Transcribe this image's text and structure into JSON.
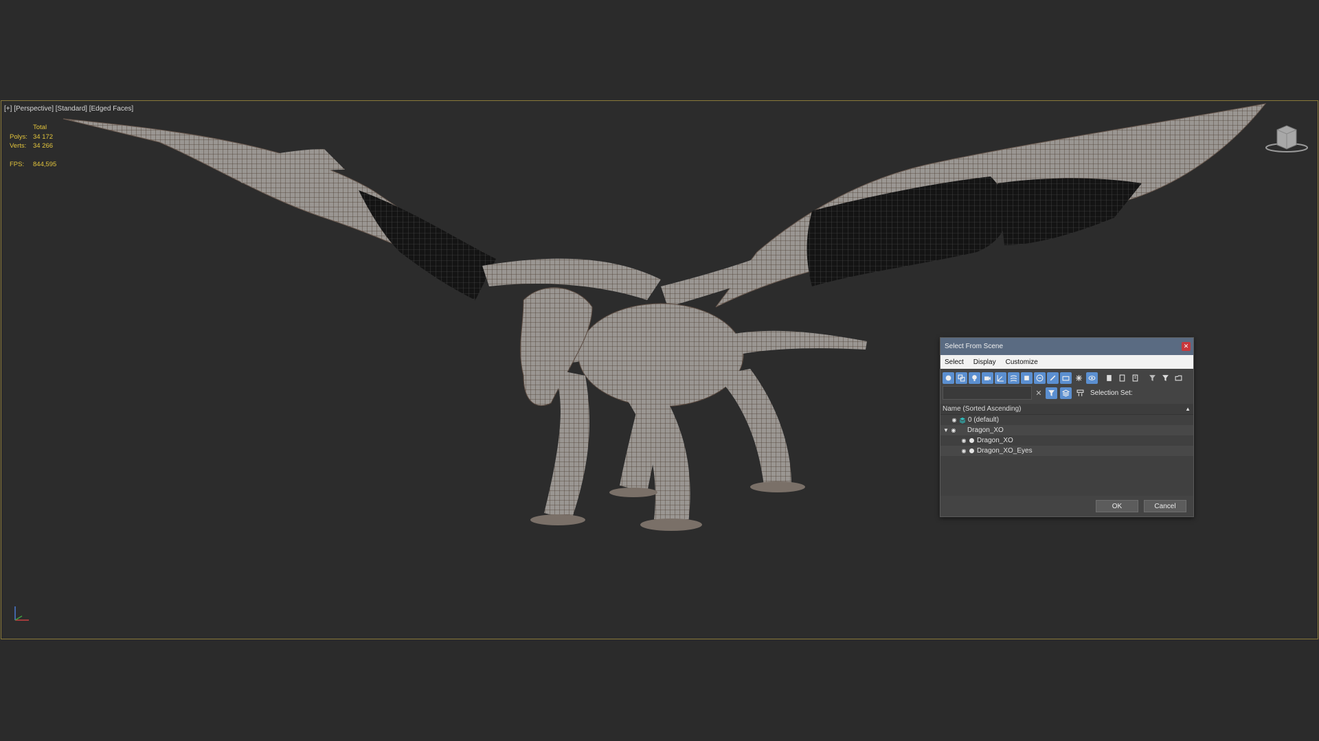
{
  "viewport": {
    "label_plus": "[+]",
    "label_view": "[Perspective]",
    "label_shading": "[Standard]",
    "label_mode": "[Edged Faces]",
    "stats": {
      "total_label": "Total",
      "polys_label": "Polys:",
      "polys_value": "34 172",
      "verts_label": "Verts:",
      "verts_value": "34 266",
      "fps_label": "FPS:",
      "fps_value": "844,595"
    },
    "colors": {
      "stats": "#e2c43c",
      "border": "#8a7a3a",
      "background": "#2c2c2c"
    }
  },
  "dialog": {
    "title": "Select From Scene",
    "close_icon": "close-icon",
    "menu": [
      "Select",
      "Display",
      "Customize"
    ],
    "toolbar_icons": [
      "geometry-icon",
      "shapes-icon",
      "lights-icon",
      "cameras-icon",
      "helpers-icon",
      "spacewarps-icon",
      "groups-icon",
      "xrefs-icon",
      "bones-icon",
      "containers-icon",
      "frozen-icon",
      "hidden-icon",
      "display-all-icon",
      "display-none-icon",
      "invert-display-icon",
      "filter-icon",
      "funnel-icon",
      "folder-icon"
    ],
    "selection_set_label": "Selection Set:",
    "search_placeholder": "",
    "column_header": "Name (Sorted Ascending)",
    "tree": [
      {
        "label": "0 (default)",
        "type": "layer"
      },
      {
        "label": "Dragon_XO",
        "type": "layer-expanded"
      },
      {
        "label": "Dragon_XO",
        "type": "object"
      },
      {
        "label": "Dragon_XO_Eyes",
        "type": "object"
      }
    ],
    "ok_label": "OK",
    "cancel_label": "Cancel",
    "colors": {
      "titlebar": "#5a6b82",
      "close": "#c8373b",
      "active": "#5b8fd0"
    }
  }
}
